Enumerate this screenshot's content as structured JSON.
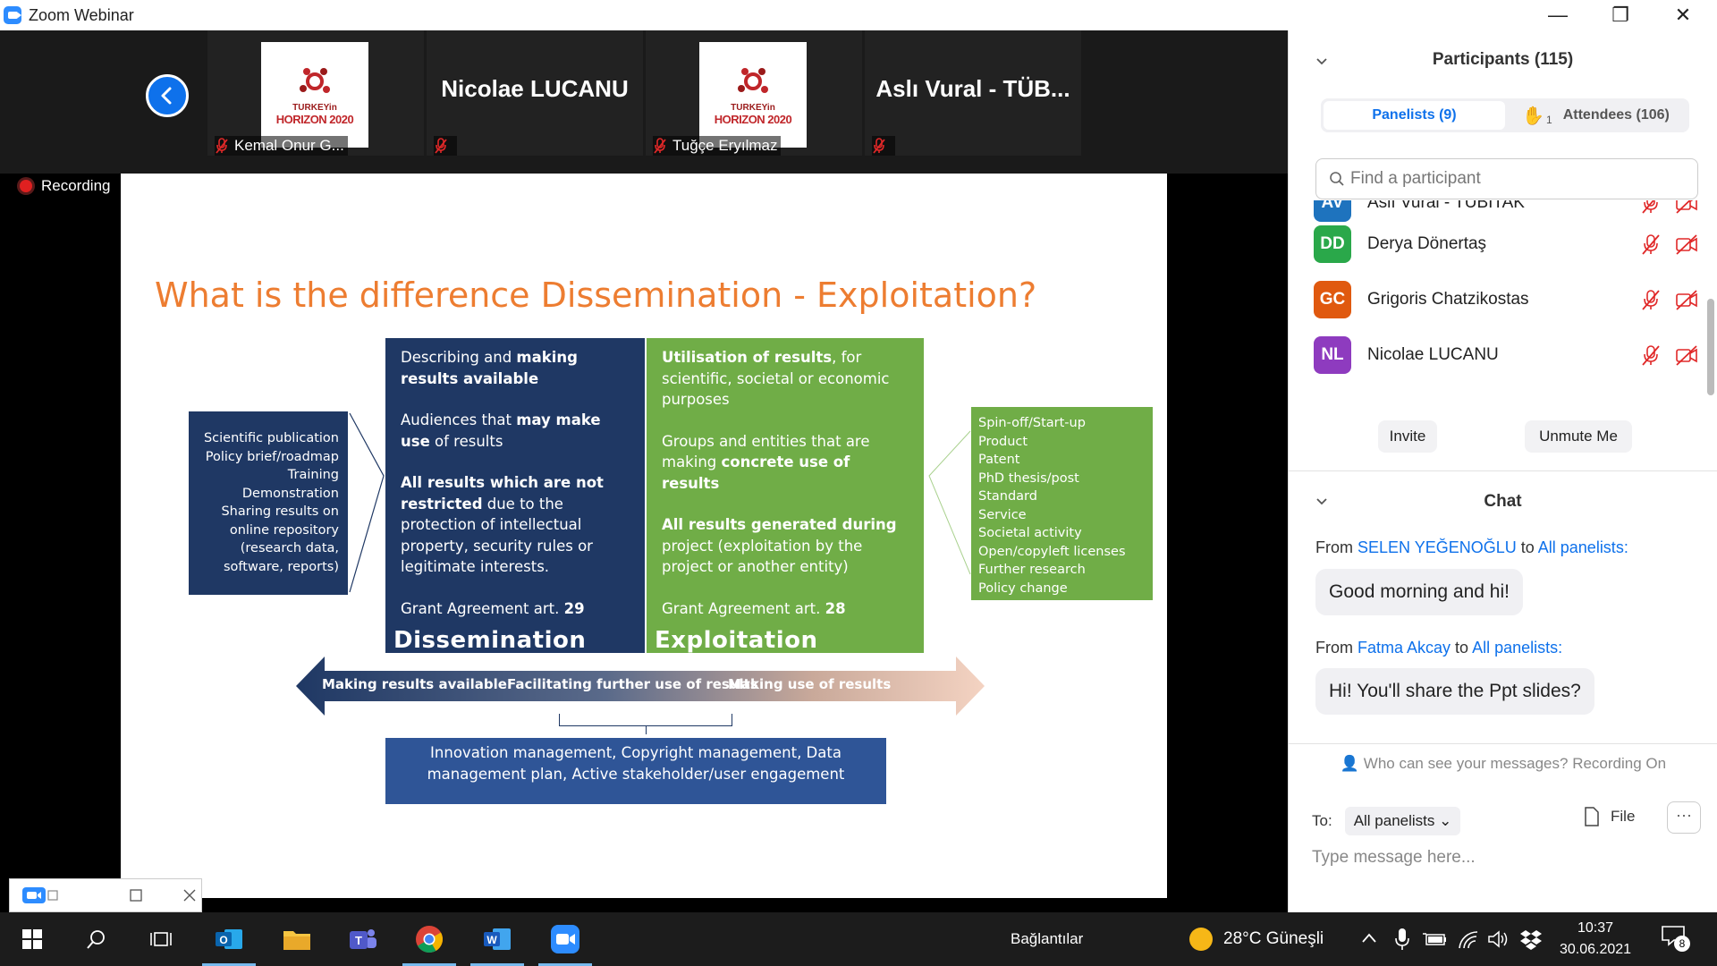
{
  "window": {
    "title": "Zoom Webinar",
    "minimize": "—",
    "restore": "❐",
    "close": "✕"
  },
  "video_strip": {
    "tiles": [
      {
        "type": "logo",
        "label": "Kemal Onur G...",
        "logo_text_1": "TURKEYin",
        "logo_text_2": "HORIZON 2020"
      },
      {
        "type": "name",
        "name": "Nicolae LUCANU"
      },
      {
        "type": "logo",
        "label": "Tuğçe Eryılmaz",
        "logo_text_1": "TURKEYin",
        "logo_text_2": "HORIZON 2020"
      },
      {
        "type": "name",
        "name": "Aslı Vural - TÜB..."
      }
    ]
  },
  "recording": {
    "label": "Recording"
  },
  "slide": {
    "title": "What is the difference Dissemination - Exploitation?",
    "left_box": [
      "Scientific publication",
      "Policy brief/roadmap",
      "Training",
      "Demonstration",
      "Sharing results on",
      "online repository",
      "(research data,",
      "software, reports)"
    ],
    "dissemination": {
      "p1_a": "Describing and ",
      "p1_b": "making results available",
      "p2_a": "Audiences that ",
      "p2_b": "may make use",
      "p2_c": " of results",
      "p3_a": "All results which are not restricted",
      "p3_b": " due to the protection of intellectual property, security rules or legitimate interests.",
      "p4_a": "Grant Agreement art. ",
      "p4_b": "29",
      "heading": "Dissemination"
    },
    "exploitation": {
      "p1_a": "Utilisation of results",
      "p1_b": ", for scientific, societal or economic purposes",
      "p2_a": "Groups and entities that are making ",
      "p2_b": "concrete use of results",
      "p3_a": "All results generated during",
      "p3_b": " project (exploitation by the project or another entity)",
      "p4_a": "Grant Agreement art. ",
      "p4_b": "28",
      "heading": "Exploitation"
    },
    "right_box": [
      "Spin-off/Start-up",
      "Product",
      "Patent",
      "PhD thesis/post",
      "Standard",
      "Service",
      "Societal activity",
      "Open/copyleft licenses",
      "Further research",
      "Policy change"
    ],
    "arrow_labels": [
      "Making results available",
      "Facilitating further use of results",
      "Making use of results"
    ],
    "innovation_box": [
      "Innovation management, Copyright management, Data",
      "management plan, Active stakeholder/user engagement"
    ]
  },
  "participants": {
    "title": "Participants (115)",
    "tab_panelists": "Panelists (9)",
    "tab_attendees": "Attendees (106)",
    "raised_hands": "1",
    "search_placeholder": "Find a participant",
    "list": [
      {
        "initials": "AV",
        "name": "Aslı Vural - TÜBİTAK",
        "color": "#1e73be"
      },
      {
        "initials": "DD",
        "name": "Derya Dönertaş",
        "color": "#2aa84a"
      },
      {
        "initials": "GC",
        "name": "Grigoris Chatzikostas",
        "color": "#e0590f"
      },
      {
        "initials": "NL",
        "name": "Nicolae LUCANU",
        "color": "#8e3bbf"
      }
    ],
    "invite": "Invite",
    "unmute": "Unmute Me"
  },
  "chat": {
    "title": "Chat",
    "messages": [
      {
        "from_label": "From ",
        "sender": "SELEN YEĞENOĞLU",
        "to_label": " to ",
        "recipient": "All panelists",
        "colon": ":",
        "text": "Good morning and hi!"
      },
      {
        "from_label": "From ",
        "sender": "Fatma Akcay",
        "to_label": " to ",
        "recipient": "All panelists",
        "colon": ":",
        "text": "Hi! You'll share the Ppt slides?"
      }
    ],
    "who_can_see": "Who can see your messages? Recording On",
    "to_label": "To:",
    "to_value": "All panelists",
    "file_label": "File",
    "more": "···",
    "placeholder": "Type message here..."
  },
  "taskbar": {
    "connections": "Bağlantılar",
    "weather": "28°C  Güneşli",
    "time": "10:37",
    "date": "30.06.2021",
    "notifications": "8"
  }
}
